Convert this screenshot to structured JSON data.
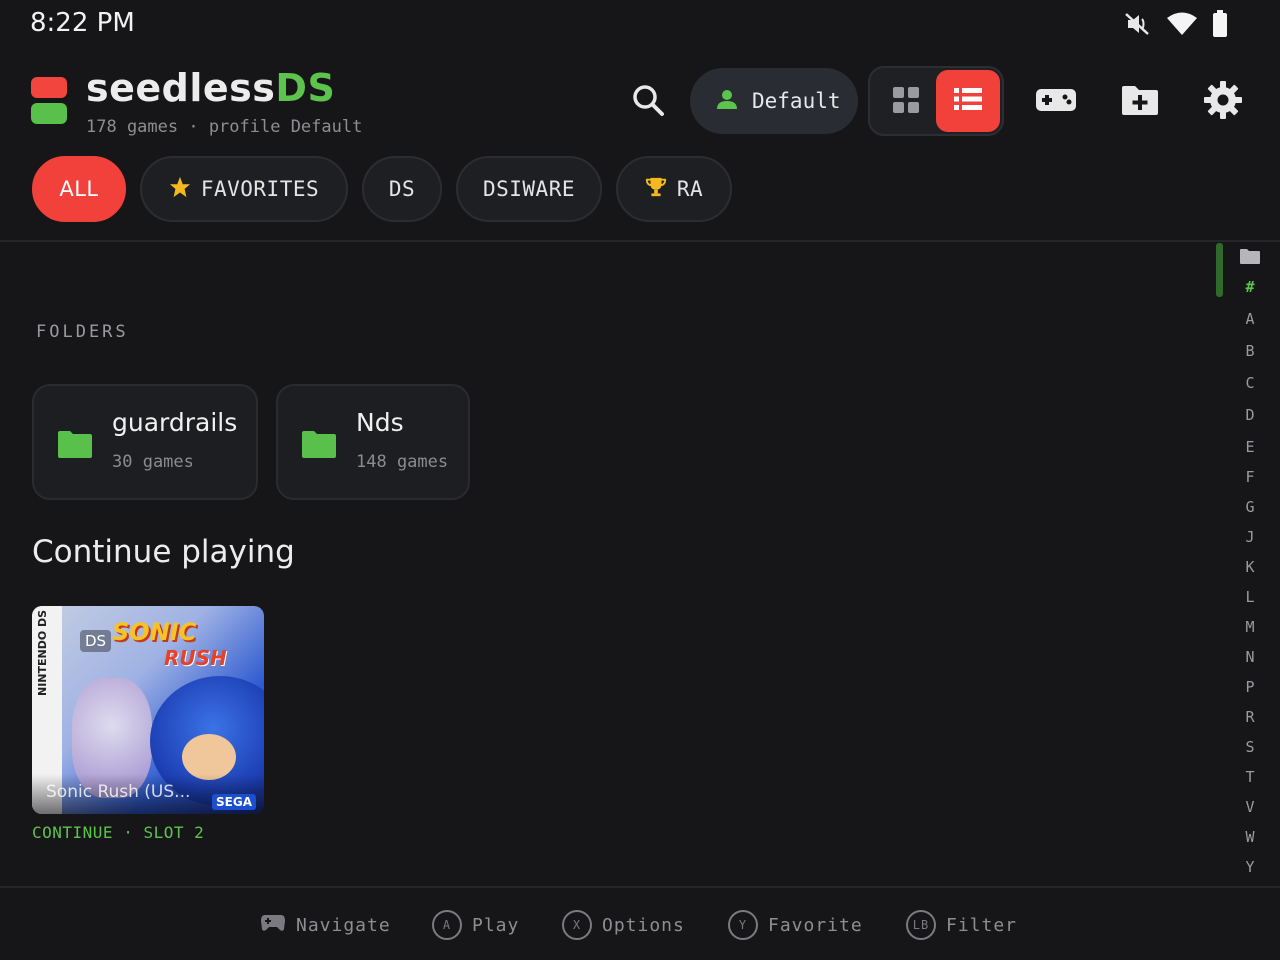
{
  "status_bar": {
    "time": "8:22 PM",
    "icons": [
      "mute-icon",
      "wifi-icon",
      "battery-icon"
    ]
  },
  "header": {
    "title_main": "seedless",
    "title_accent": "DS",
    "subtitle": "178 games · profile Default",
    "profile_label": "Default",
    "icons": [
      "search-icon",
      "person-icon",
      "grid-view-icon",
      "list-view-icon",
      "gamepad-icon",
      "add-folder-icon",
      "gear-icon"
    ]
  },
  "filters": [
    {
      "label": "ALL",
      "active": true
    },
    {
      "label": "FAVORITES",
      "icon": "star-icon"
    },
    {
      "label": "DS"
    },
    {
      "label": "DSIWARE"
    },
    {
      "label": "RA",
      "icon": "trophy-icon"
    }
  ],
  "folders": {
    "heading": "FOLDERS",
    "items": [
      {
        "name": "guardrails",
        "count": "30 games"
      },
      {
        "name": "Nds",
        "count": "148 games"
      }
    ]
  },
  "continue_playing": {
    "heading": "Continue playing",
    "games": [
      {
        "title_overlay": "Sonic Rush (US...",
        "platform": "DS",
        "art_title": "SONIC",
        "art_subtitle": "RUSH",
        "strip_text": "NINTENDO DS",
        "publisher": "SEGA",
        "caption": "CONTINUE · SLOT 2"
      }
    ]
  },
  "alpha_index": [
    "#",
    "A",
    "B",
    "C",
    "D",
    "E",
    "F",
    "G",
    "J",
    "K",
    "L",
    "M",
    "N",
    "P",
    "R",
    "S",
    "T",
    "V",
    "W",
    "Y"
  ],
  "footer_hints": [
    {
      "glyph": "gamepad-icon",
      "label": "Navigate"
    },
    {
      "glyph": "A",
      "label": "Play"
    },
    {
      "glyph": "X",
      "label": "Options"
    },
    {
      "glyph": "Y",
      "label": "Favorite"
    },
    {
      "glyph": "LB",
      "label": "Filter"
    }
  ],
  "colors": {
    "accent_red": "#f2413a",
    "accent_green": "#5cc44c",
    "background": "#161618"
  }
}
